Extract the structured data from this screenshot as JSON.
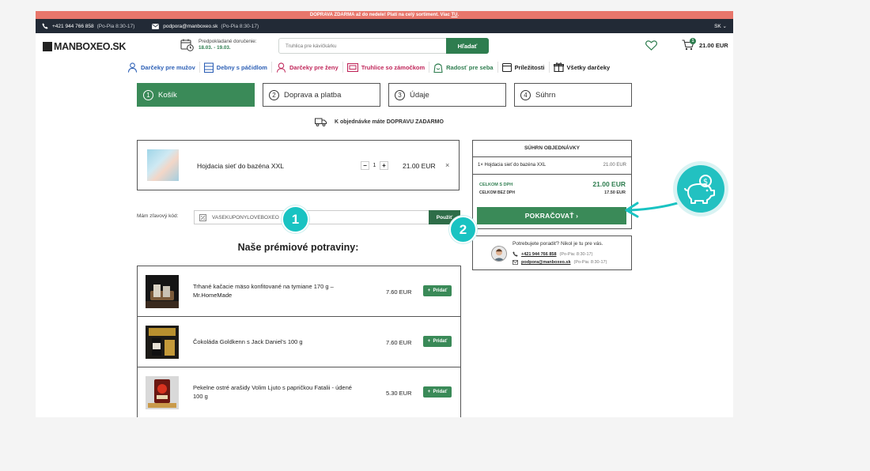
{
  "promo": {
    "text": "DOPRAVA ZDARMA až do nedele! Platí na celý sortiment. Viac",
    "link": "TU",
    "suffix": "."
  },
  "topbar": {
    "phone": "+421 944 766 858",
    "phone_hours": "(Po-Pia 8:30-17)",
    "email": "podpora@manboxeo.sk",
    "email_hours": "(Po-Pia 8:30-17)",
    "lang": "SK"
  },
  "header": {
    "logo": "MANBOXEO.SK",
    "delivery_label": "Predpokladané doručenie:",
    "delivery_dates": "18.03. - 19.03.",
    "search_placeholder": "Truhlica pre kávičkárku",
    "search_button": "Hľadať",
    "cart_count": "1",
    "cart_total": "21.00 EUR"
  },
  "categories": [
    {
      "label": "Darčeky pre mužov",
      "color": "#2c5fb5",
      "icon": "man-icon"
    },
    {
      "label": "Debny s páčidlom",
      "color": "#2c5fb5",
      "icon": "crate-icon"
    },
    {
      "label": "Darčeky pre ženy",
      "color": "#c0265a",
      "icon": "woman-icon"
    },
    {
      "label": "Truhlice so zámočkom",
      "color": "#c0265a",
      "icon": "chest-icon"
    },
    {
      "label": "Radosť pre seba",
      "color": "#2e7d4f",
      "icon": "gift-bag-icon"
    },
    {
      "label": "Príležitosti",
      "color": "#222222",
      "icon": "calendar-icon"
    },
    {
      "label": "Všetky darčeky",
      "color": "#222222",
      "icon": "gift-icon"
    }
  ],
  "steps": [
    {
      "num": "1",
      "label": "Košík",
      "active": true
    },
    {
      "num": "2",
      "label": "Doprava a platba",
      "active": false
    },
    {
      "num": "3",
      "label": "Údaje",
      "active": false
    },
    {
      "num": "4",
      "label": "Súhrn",
      "active": false
    }
  ],
  "free_shipping": "K objednávke máte DOPRAVU ZADARMO",
  "cart_item": {
    "name": "Hojdacia sieť do bazéna XXL",
    "qty": "1",
    "price": "21.00 EUR",
    "remove": "×"
  },
  "coupon": {
    "label": "Mám zľavový kód:",
    "value": "VASEKUPONYLOVEBOXEO",
    "button": "Použiť"
  },
  "callouts": [
    "1",
    "2"
  ],
  "premium": {
    "title": "Naše prémiové potraviny:",
    "add_label": "Pridať",
    "items": [
      {
        "name": "Trhané kačacie mäso konfitované na tymiane 170 g – Mr.HomeMade",
        "price": "7.60 EUR"
      },
      {
        "name": "Čokoláda Goldkenn s Jack Daniel's 100 g",
        "price": "7.60 EUR"
      },
      {
        "name": "Pekelne ostré arašidy Volim Ljuto s papričkou Fatalii - údené 100 g",
        "price": "5.30 EUR"
      }
    ]
  },
  "summary": {
    "title": "SÚHRN OBJEDNÁVKY",
    "line_label": "1× Hojdacia sieť do bazéna XXL",
    "line_price": "21.00 EUR",
    "total_label": "CELKOM S DPH",
    "total_value": "21.00 EUR",
    "net_label": "CELKOM BEZ DPH",
    "net_value": "17.50 EUR",
    "continue": "POKRAČOVAŤ ›"
  },
  "help": {
    "question": "Potrebujete poradiť? Nikol je tu pre vás.",
    "phone": "+421 944 766 858",
    "phone_hours": "(Po-Pia: 8:30-17)",
    "email": "podpora@manboxeo.sk",
    "email_hours": "(Po-Pia: 8:30-17)"
  },
  "accent_color": "#19c3c2",
  "brand_green": "#3a8a58"
}
